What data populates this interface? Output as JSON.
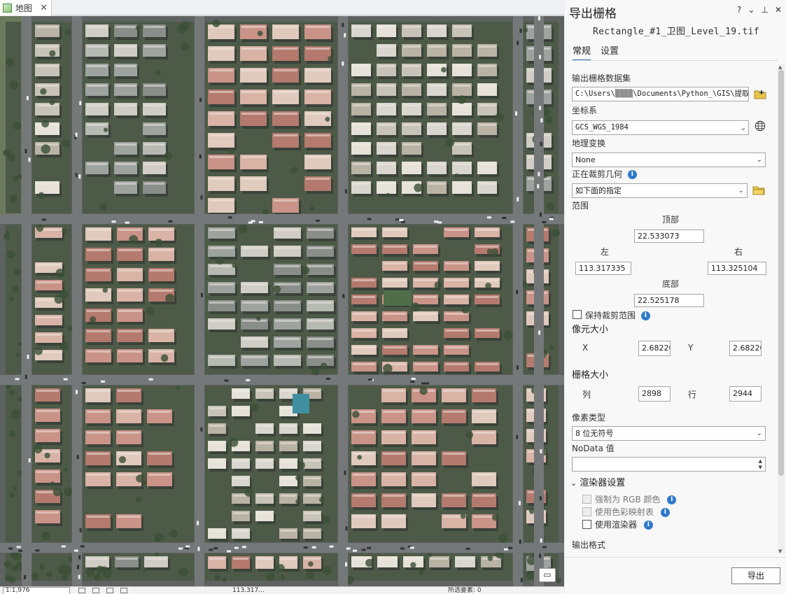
{
  "map": {
    "tab_label": "地图",
    "status": {
      "scale": "1:1,976",
      "coordinates": "113.317...",
      "selected": "所选要素: 0"
    }
  },
  "gp": {
    "title": "导出栅格",
    "controls": [
      "?",
      "⌄",
      "⊥",
      "✕"
    ],
    "filename": "Rectangle_#1_卫图_Level_19.tif",
    "tabs": [
      "常规",
      "设置"
    ],
    "output_label": "输出栅格数据集",
    "output_value": "C:\\Users\\▒▒▒▒\\Documents\\Python_\\GIS\\提取",
    "crs_label": "坐标系",
    "crs_value": "GCS_WGS_1984",
    "geo_transform_label": "地理变换",
    "geo_transform_value": "None",
    "clip_geometry_label": "正在裁剪几何",
    "clip_geometry_value": "如下面的指定",
    "extent_label": "范围",
    "top_label": "顶部",
    "top_value": "22.533073",
    "left_label": "左",
    "left_value": "113.317335",
    "right_label": "右",
    "right_value": "113.325104",
    "bottom_label": "底部",
    "bottom_value": "22.525178",
    "keep_clip_label": "保持裁剪范围",
    "cell_size_label": "像元大小",
    "x_label": "X",
    "x_value": "2.68220",
    "y_label": "Y",
    "y_value": "2.68220",
    "raster_size_label": "栅格大小",
    "cols_label": "列",
    "cols_value": "2898",
    "rows_label": "行",
    "rows_value": "2944",
    "pixel_type_label": "像素类型",
    "pixel_type_value": "8 位无符号",
    "nodata_label": "NoData 值",
    "nodata_value": "",
    "renderer_section_label": "渲染器设置",
    "force_rgb_label": "强制为 RGB 颜色",
    "use_colormap_label": "使用色彩映射表",
    "use_renderer_label": "使用渲染器",
    "output_format_label": "输出格式",
    "export_button": "导出",
    "info_glyph": "i"
  },
  "colors": {
    "accent": "#2f6db5",
    "info": "#2f79c9",
    "road": "#6f7275",
    "roof_red": "#c98a7e",
    "vegetation": "#3d5a3a"
  }
}
